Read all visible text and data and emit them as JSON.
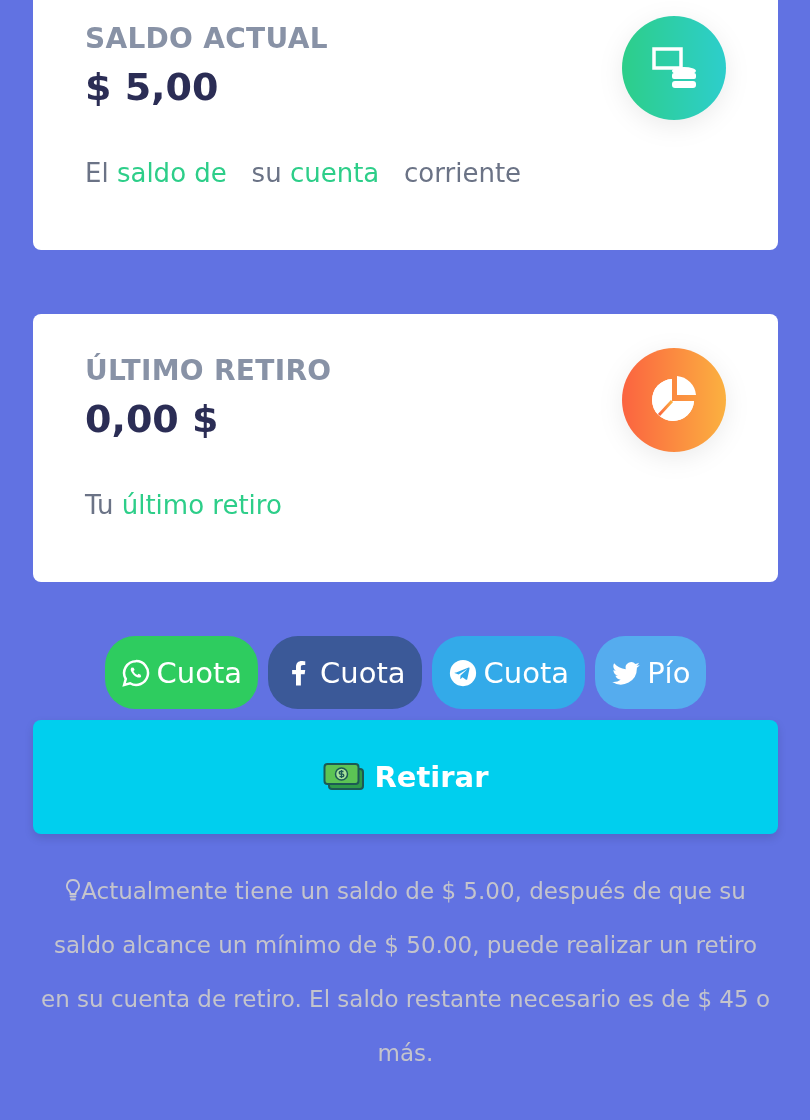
{
  "cards": [
    {
      "title": "SALDO ACTUAL",
      "value": "$ 5,00",
      "kind": "balance",
      "caption": [
        {
          "text": "El ",
          "highlight": false
        },
        {
          "text": "saldo de",
          "highlight": true
        },
        {
          "text": "   su ",
          "highlight": false
        },
        {
          "text": "cuenta",
          "highlight": true
        },
        {
          "text": "   corriente",
          "highlight": false
        }
      ]
    },
    {
      "title": "ÚLTIMO RETIRO",
      "value": "0,00 $",
      "kind": "withdrawal",
      "caption": [
        {
          "text": "Tu ",
          "highlight": false
        },
        {
          "text": "último retiro",
          "highlight": true
        }
      ]
    }
  ],
  "share_buttons": [
    {
      "kind": "whatsapp",
      "label": "Cuota",
      "color": "#2ecc5f"
    },
    {
      "kind": "facebook",
      "label": "Cuota",
      "color": "#3b5998"
    },
    {
      "kind": "telegram",
      "label": "Cuota",
      "color": "#33aae9"
    },
    {
      "kind": "twitter",
      "label": "Pío",
      "color": "#55acee"
    }
  ],
  "withdraw_button": {
    "label": "Retirar"
  },
  "note": "Actualmente tiene un saldo de $ 5.00, después de que su saldo alcance un mínimo de $ 50.00, puede realizar un retiro en su cuenta de retiro. El saldo restante necesario es de $ 45 o más."
}
